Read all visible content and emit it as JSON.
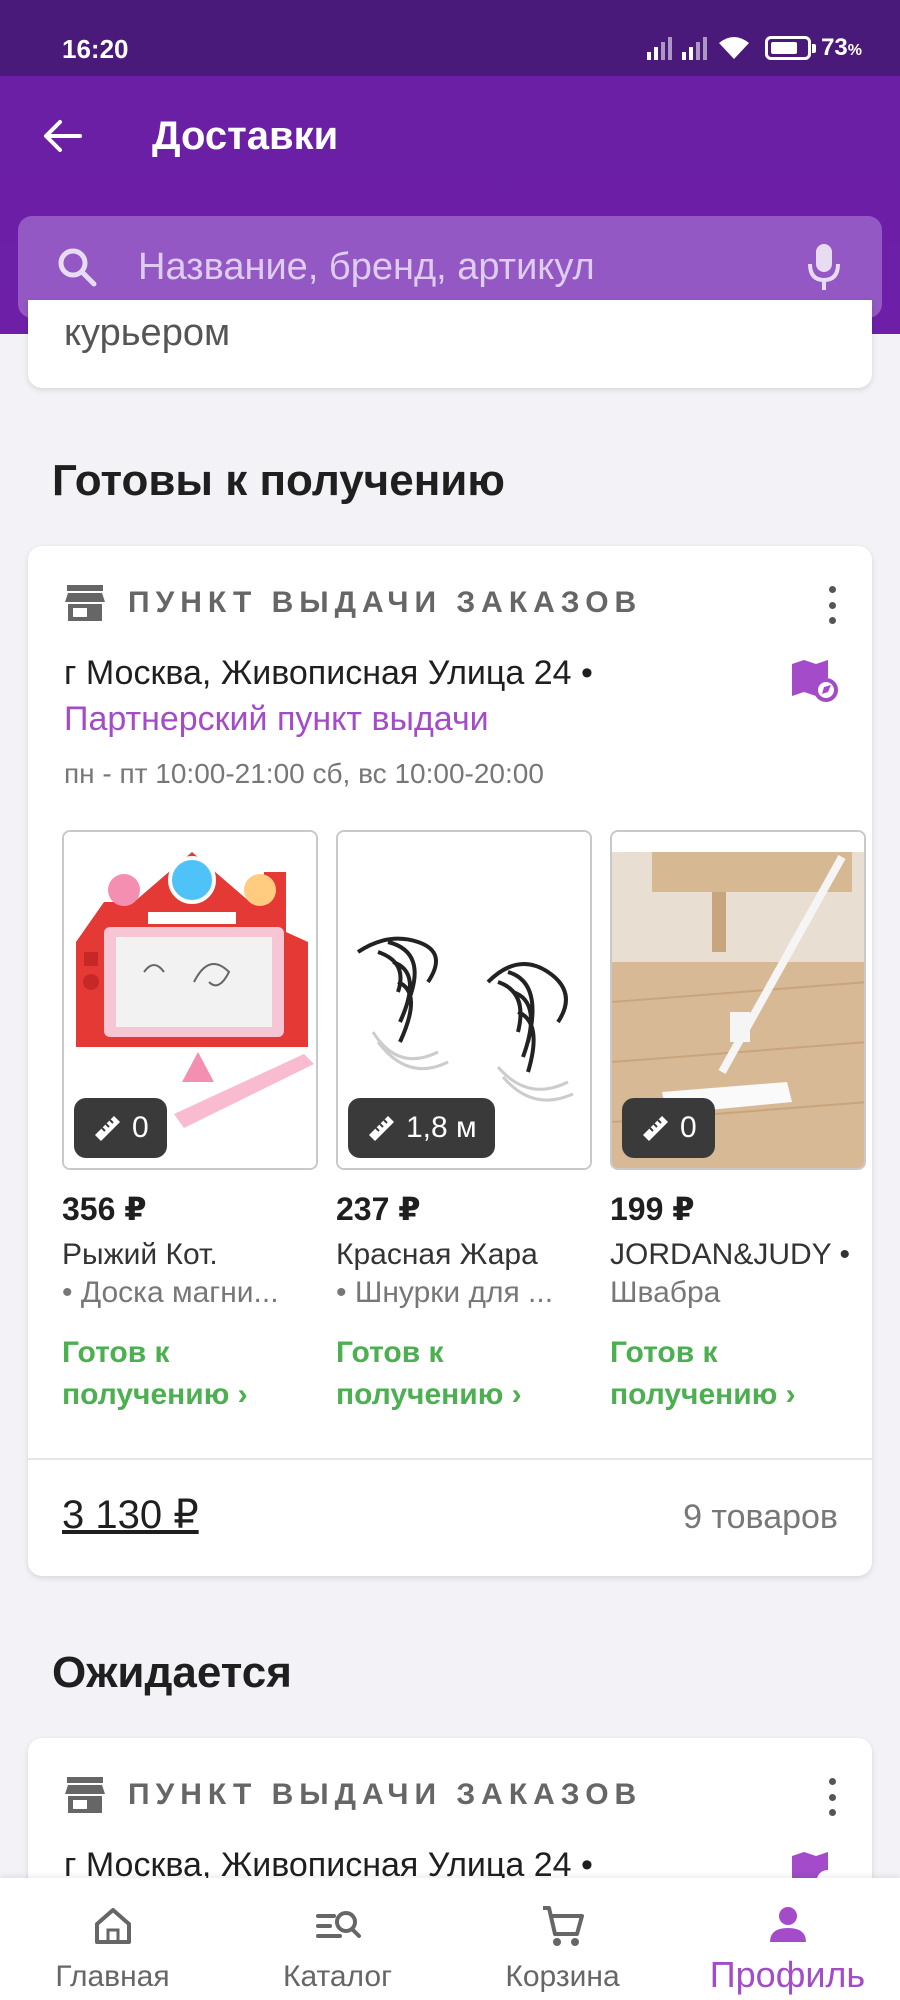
{
  "status_bar": {
    "time": "16:20",
    "battery": "73",
    "battery_unit": "%"
  },
  "header": {
    "title": "Доставки"
  },
  "search": {
    "placeholder": "Название, бренд, артикул"
  },
  "prev_card_fragment": {
    "text": "курьером"
  },
  "sections": {
    "ready_title": "Готовы к получению",
    "expected_title": "Ожидается"
  },
  "ready_card": {
    "pickup_label": "ПУНКТ ВЫДАЧИ ЗАКАЗОВ",
    "address": "г Москва, Живописная Улица 24 •",
    "partner": "Партнерский пункт выдачи",
    "hours": "пн - пт 10:00-21:00 сб, вс 10:00-20:00",
    "items": [
      {
        "size": "0",
        "price": "356 ₽",
        "brand": "Рыжий Кот.",
        "desc": "• Доска магни...",
        "status_line1": "Готов к",
        "status_line2": "получению ›"
      },
      {
        "size": "1,8 м",
        "price": "237 ₽",
        "brand": "Красная Жара",
        "desc": "• Шнурки для ...",
        "status_line1": "Готов к",
        "status_line2": "получению ›"
      },
      {
        "size": "0",
        "price": "199 ₽",
        "brand": "JORDAN&JUDY •",
        "desc": "Швабра",
        "status_line1": "Готов к",
        "status_line2": "получению ›"
      }
    ],
    "total": "3 130 ₽",
    "count": "9 товаров"
  },
  "expected_card": {
    "pickup_label": "ПУНКТ ВЫДАЧИ ЗАКАЗОВ",
    "address": "г Москва, Живописная Улица 24 •"
  },
  "bottom_nav": [
    {
      "label": "Главная",
      "icon": "home-icon"
    },
    {
      "label": "Каталог",
      "icon": "catalog-search-icon"
    },
    {
      "label": "Корзина",
      "icon": "cart-icon"
    },
    {
      "label": "Профиль",
      "icon": "profile-icon",
      "active": true
    }
  ],
  "colors": {
    "brand_purple": "#6d1fa8",
    "accent_purple": "#a34bc9",
    "ready_green": "#4caf50"
  }
}
